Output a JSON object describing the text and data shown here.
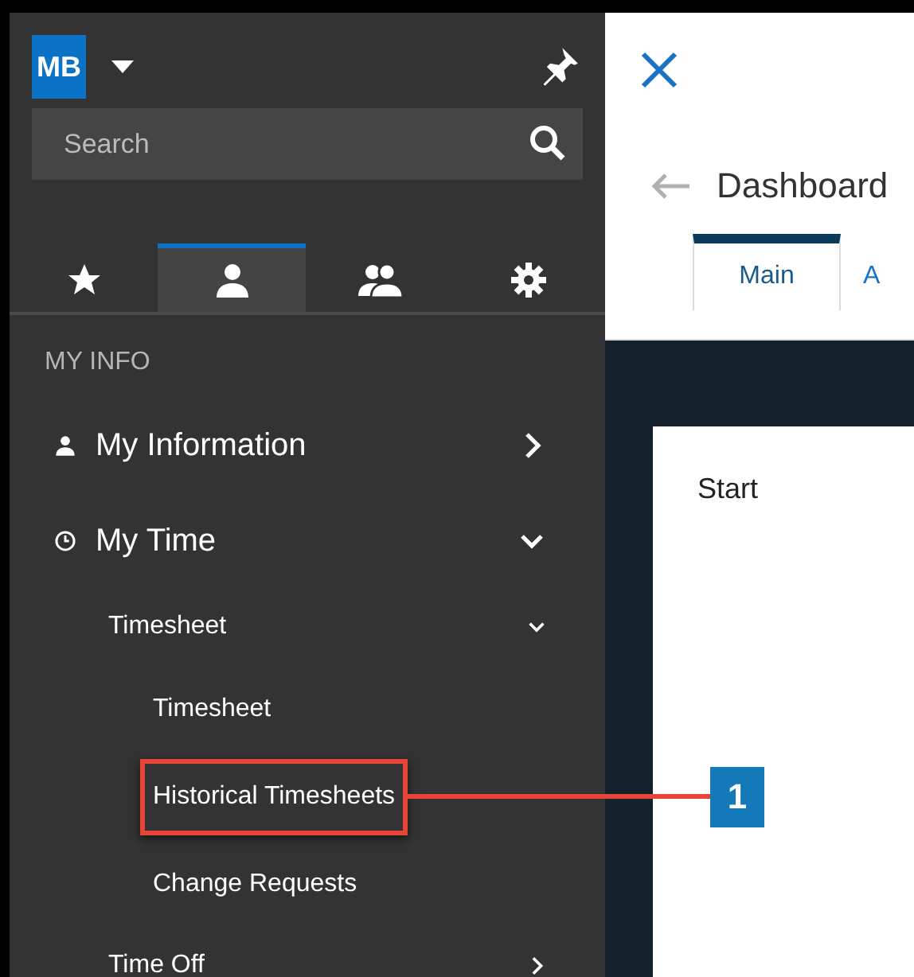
{
  "sidebar": {
    "avatar": "MB",
    "search": {
      "placeholder": "Search"
    },
    "tabs": [
      {
        "selected": false
      },
      {
        "selected": true
      },
      {
        "selected": false
      },
      {
        "selected": false
      }
    ],
    "section": "MY INFO",
    "items": [
      {
        "label": "My Information",
        "expanded": false
      },
      {
        "label": "My Time",
        "expanded": true,
        "children": [
          {
            "label": "Timesheet",
            "expanded": true,
            "children": [
              {
                "label": "Timesheet",
                "highlighted": false
              },
              {
                "label": "Historical Timesheets",
                "highlighted": true
              },
              {
                "label": "Change Requests",
                "highlighted": false
              }
            ]
          },
          {
            "label": "Time Off",
            "expanded": false
          }
        ]
      }
    ]
  },
  "main": {
    "title": "Dashboard",
    "tabs": [
      {
        "label": "Main",
        "selected": true
      },
      {
        "label": "A",
        "selected": false
      }
    ],
    "card": {
      "title": "Start"
    }
  },
  "callout": {
    "label": "1"
  }
}
